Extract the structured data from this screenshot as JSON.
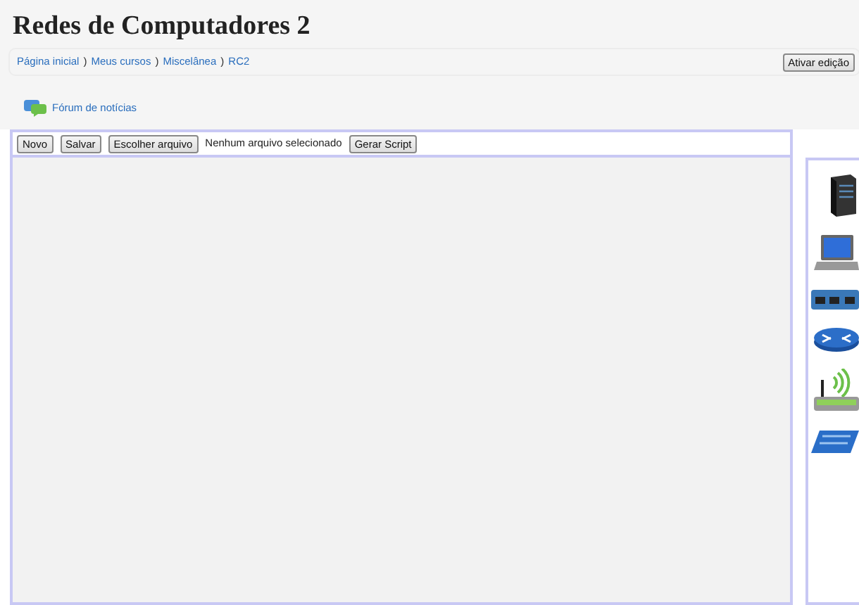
{
  "title": "Redes de Computadores 2",
  "breadcrumb": [
    "Página inicial",
    "Meus cursos",
    "Miscelânea",
    "RC2"
  ],
  "breadcrumb_separator": ")",
  "edit_button": "Ativar edição",
  "forum_link": "Fórum de notícias",
  "toolbar": [
    {
      "kind": "button",
      "label": "Novo"
    },
    {
      "kind": "button",
      "label": "Salvar"
    },
    {
      "kind": "file",
      "label": "Escolher arquivo",
      "status": "Nenhum arquivo selecionado"
    },
    {
      "kind": "button",
      "label": "Gerar Script"
    }
  ]
}
